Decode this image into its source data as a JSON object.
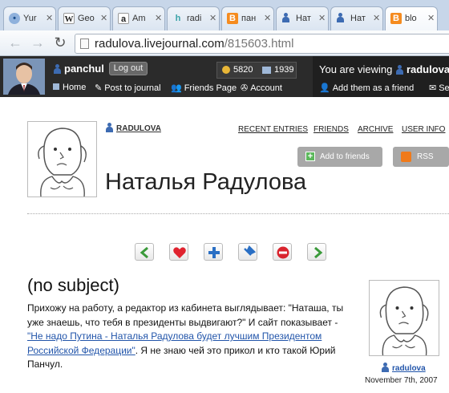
{
  "browser": {
    "tabs": [
      {
        "icon": "globe-icon",
        "title": "Yur"
      },
      {
        "icon": "wikipedia-icon",
        "title": "Geo"
      },
      {
        "icon": "amazon-icon",
        "title": "Am"
      },
      {
        "icon": "h-icon",
        "title": "radi"
      },
      {
        "icon": "blogger-icon",
        "title": "пан"
      },
      {
        "icon": "lj-user-icon",
        "title": "Нат"
      },
      {
        "icon": "lj-user-icon",
        "title": "Нат"
      },
      {
        "icon": "blogger-icon",
        "title": "blo"
      }
    ],
    "url_host": "radulova.livejournal.com",
    "url_path": "/815603.html"
  },
  "ljbar": {
    "username": "panchul",
    "logout_label": "Log out",
    "points": "5820",
    "messages": "1939",
    "links": [
      "Home",
      "Post to journal",
      "Friends Page",
      "Account"
    ],
    "viewing_prefix": "You are viewing",
    "viewing_user": "radulova",
    "add_friend_label": "Add them as a friend",
    "send_label": "Send"
  },
  "journal": {
    "nick": "RADULOVA",
    "menu": [
      "RECENT ENTRIES",
      "FRIENDS",
      "ARCHIVE",
      "USER INFO"
    ],
    "add_to_friends": "Add to friends",
    "rss": "RSS",
    "title": "Наталья Радулова"
  },
  "actions": [
    "prev-icon",
    "heart-icon",
    "plus-icon",
    "pin-icon",
    "stop-icon",
    "next-icon"
  ],
  "entry": {
    "subject": "(no subject)",
    "text1": "Прихожу на работу, а редактор из кабинета выглядывает: \"Наташа, ты уже знаешь, что тебя в президенты выдвигают?\" И сайт показывает - ",
    "link": "\"Не надо Путина - Наталья Радулова будет лучшим Президентом Российской Федерации\"",
    "text2": ". Я не знаю чей это прикол и кто такой Юрий Панчул.",
    "poster": "radulova",
    "date": "November 7th, 2007"
  },
  "colors": {
    "ljbar": "#2b2b2b",
    "link": "#2255aa",
    "pill_button": "#a8a8a8"
  }
}
